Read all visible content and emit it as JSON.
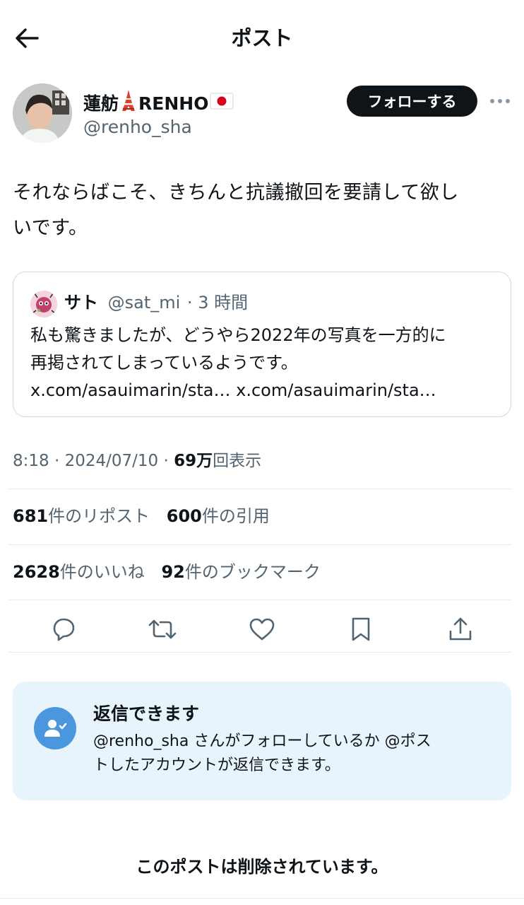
{
  "header": {
    "title": "ポスト"
  },
  "author": {
    "name": "蓮舫",
    "name_suffix": "RENHO",
    "handle": "@renho_sha",
    "follow_label": "フォローする"
  },
  "post": {
    "line1": "それならばこそ、きちんと抗議撤回を要請して欲し",
    "line2": "いです。"
  },
  "quote": {
    "name": "サト",
    "handle": "@sat_mi",
    "time": "· 3 時間",
    "body_line1": "私も驚きましたが、どうやら2022年の写真を一方的に",
    "body_line2": "再掲されてしまっているようです。",
    "links": "x.com/asauimarin/sta… x.com/asauimarin/sta…"
  },
  "meta": {
    "time": "8:18 · 2024/07/10 · ",
    "views_count": "69万",
    "views_label": "回表示"
  },
  "stats": {
    "reposts_count": "681",
    "reposts_label": "件のリポスト",
    "quotes_count": "600",
    "quotes_label": "件の引用",
    "likes_count": "2628",
    "likes_label": "件のいいね",
    "bookmarks_count": "92",
    "bookmarks_label": "件のブックマーク"
  },
  "actions": [
    "reply-icon",
    "repost-icon",
    "like-icon",
    "bookmark-icon",
    "share-icon"
  ],
  "reply_notice": {
    "title": "返信できます",
    "desc_line1": "@renho_sha さんがフォローしているか @ポス",
    "desc_line2": "トしたアカウントが返信できます。"
  },
  "footer": {
    "deleted_text": "このポストは削除されています。"
  },
  "colors": {
    "text": "#0f1419",
    "secondary": "#536471",
    "border": "#cfd9de",
    "reply_bg": "#e8f4fb",
    "reply_icon": "#4a97de"
  }
}
